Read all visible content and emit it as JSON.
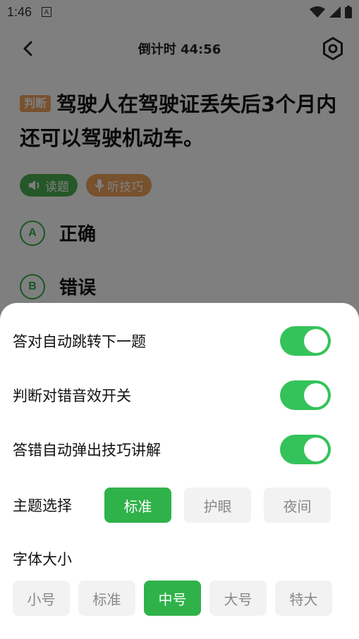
{
  "status_bar": {
    "time": "1:46",
    "badge": "A"
  },
  "header": {
    "title": "倒计时 44:56"
  },
  "question": {
    "tag": "判断",
    "text": "驾驶人在驾驶证丢失后3个月内还可以驾驶机动车。"
  },
  "pills": {
    "read": "读题",
    "listen": "听技巧"
  },
  "options": [
    {
      "letter": "A",
      "text": "正确"
    },
    {
      "letter": "B",
      "text": "错误"
    }
  ],
  "settings": {
    "toggles": [
      {
        "label": "答对自动跳转下一题",
        "on": true
      },
      {
        "label": "判断对错音效开关",
        "on": true
      },
      {
        "label": "答错自动弹出技巧讲解",
        "on": true
      }
    ],
    "theme": {
      "label": "主题选择",
      "options": [
        "标准",
        "护眼",
        "夜间"
      ],
      "selected": "标准"
    },
    "font": {
      "label": "字体大小",
      "options": [
        "小号",
        "标准",
        "中号",
        "大号",
        "特大"
      ],
      "selected": "中号"
    }
  },
  "colors": {
    "accent": "#2fb24a",
    "tag": "#f0a35a",
    "toggle_on": "#34c35a"
  }
}
